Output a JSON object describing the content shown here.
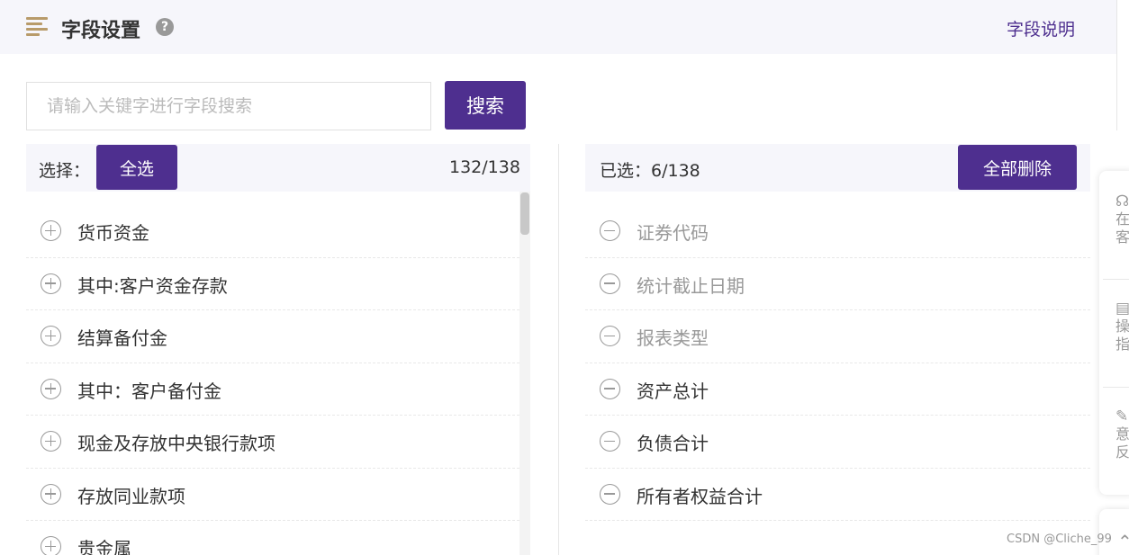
{
  "header": {
    "title": "字段设置",
    "help_icon": "?",
    "link": "字段说明"
  },
  "search": {
    "placeholder": "请输入关键字进行字段搜索",
    "value": "",
    "button": "搜索"
  },
  "left_panel": {
    "label": "选择：",
    "select_all": "全选",
    "count": "132/138",
    "items": [
      "货币资金",
      "其中:客户资金存款",
      "结算备付金",
      "其中：客户备付金",
      "现金及存放中央银行款项",
      "存放同业款项",
      "贵金属"
    ]
  },
  "right_panel": {
    "label": "已选：6/138",
    "delete_all": "全部删除",
    "items": [
      {
        "label": "证券代码",
        "locked": true
      },
      {
        "label": "统计截止日期",
        "locked": true
      },
      {
        "label": "报表类型",
        "locked": true
      },
      {
        "label": "资产总计",
        "locked": false
      },
      {
        "label": "负债合计",
        "locked": false
      },
      {
        "label": "所有者权益合计",
        "locked": false
      }
    ]
  },
  "side_tools": {
    "items": [
      {
        "icon": "headset-icon",
        "label": "在客"
      },
      {
        "icon": "document-icon",
        "label": "操指"
      },
      {
        "icon": "feedback-icon",
        "label": "意反"
      }
    ]
  },
  "watermark": "CSDN @Cliche_99",
  "colors": {
    "accent": "#4e2f8f",
    "header_bg": "#f6f6fb",
    "menu_icon": "#b89b6a"
  }
}
